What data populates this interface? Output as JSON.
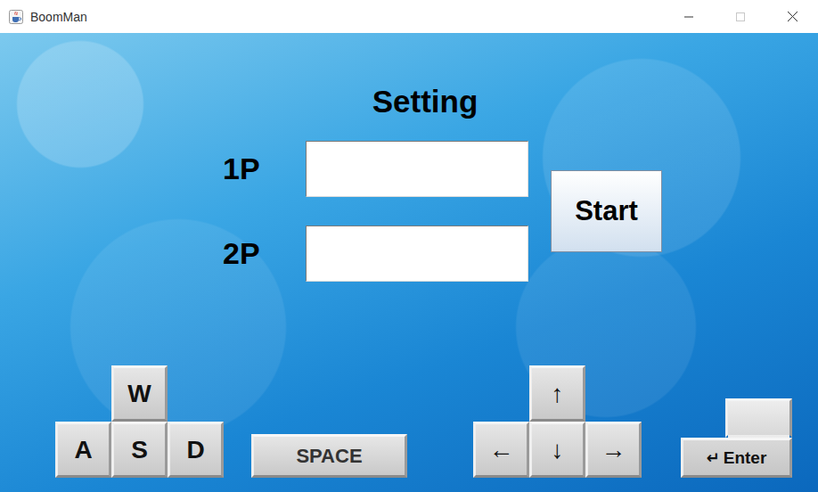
{
  "window": {
    "title": "BoomMan"
  },
  "heading": "Setting",
  "players": [
    {
      "label": "1P",
      "value": ""
    },
    {
      "label": "2P",
      "value": ""
    }
  ],
  "start_button": "Start",
  "controls": {
    "player1": {
      "up": "W",
      "left": "A",
      "down": "S",
      "right": "D",
      "action": "SPACE"
    },
    "player2": {
      "up": "↑",
      "left": "←",
      "down": "↓",
      "right": "→",
      "action": {
        "icon": "↵",
        "label": "Enter"
      }
    }
  }
}
